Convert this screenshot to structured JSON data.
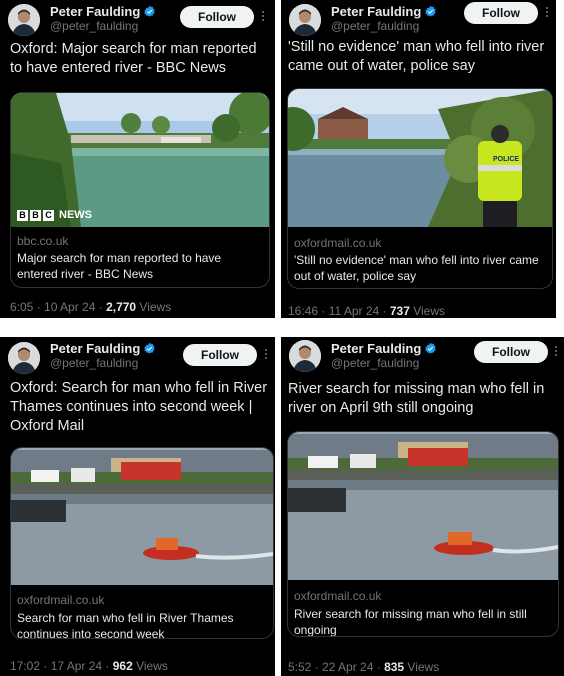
{
  "tweets": [
    {
      "author": "Peter Faulding",
      "handle": "@peter_faulding",
      "follow_label": "Follow",
      "text": "Oxford: Major search for man reported to have entered river - BBC News",
      "card_domain": "bbc.co.uk",
      "card_title": "Major search for man reported to have entered river - BBC News",
      "image_badge": "NEWS",
      "bbc_letters": [
        "B",
        "B",
        "C"
      ],
      "time": "6:05 · 10 Apr 24 · ",
      "views_count": "2,770",
      "views_label": " Views"
    },
    {
      "author": "Peter Faulding",
      "handle": "@peter_faulding",
      "follow_label": "Follow",
      "text": "'Still no evidence' man who fell into river came out of water, police say",
      "card_domain": "oxfordmail.co.uk",
      "card_title": "'Still no evidence' man who fell into river came out of water, police say",
      "police_text": "POLICE",
      "time": "16:46 · 11 Apr 24 · ",
      "views_count": "737",
      "views_label": " Views"
    },
    {
      "author": "Peter Faulding",
      "handle": "@peter_faulding",
      "follow_label": "Follow",
      "text": "Oxford: Search for man who fell in River Thames continues into second week | Oxford Mail",
      "card_domain": "oxfordmail.co.uk",
      "card_title": "Search for man who fell in River Thames continues into second week",
      "time": "17:02 · 17 Apr 24 · ",
      "views_count": "962",
      "views_label": " Views"
    },
    {
      "author": "Peter Faulding",
      "handle": "@peter_faulding",
      "follow_label": "Follow",
      "text": "River search for missing man who fell in river on April 9th still ongoing",
      "card_domain": "oxfordmail.co.uk",
      "card_title": "River search for missing man who fell in still ongoing",
      "time": "5:52 · 22 Apr 24 · ",
      "views_count": "835",
      "views_label": " Views"
    }
  ],
  "icons": {
    "verified": "verified-badge-icon",
    "more": "more-options-icon"
  },
  "colors": {
    "background": "#000000",
    "verified": "#1d9bf0",
    "muted": "#71767b",
    "text": "#e7e9ea"
  }
}
